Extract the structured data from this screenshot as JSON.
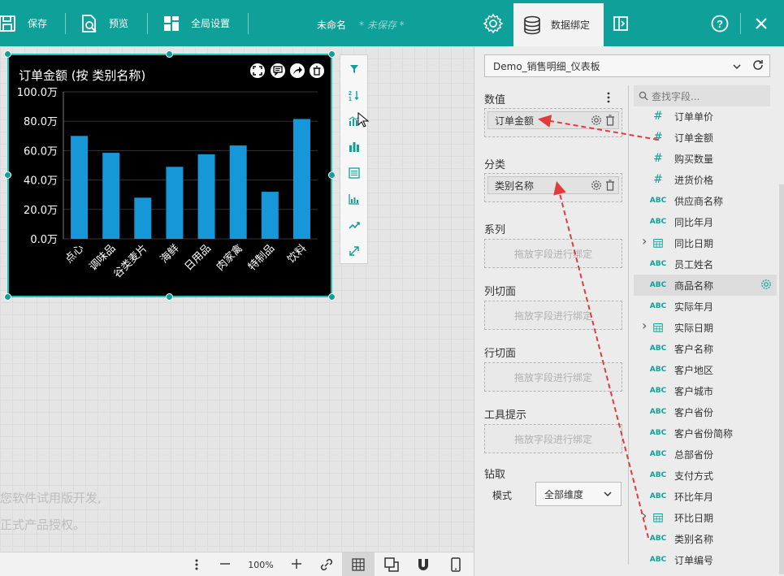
{
  "toolbar": {
    "save": "保存",
    "preview": "预览",
    "global_settings": "全局设置",
    "doc_title": "未命名",
    "unsaved": "* 未保存 *",
    "data_binding": "数据绑定",
    "accent": "#0fa09a"
  },
  "chart_data": {
    "type": "bar",
    "title": "订单金额 (按 类别名称)",
    "categories": [
      "点心",
      "调味品",
      "谷类麦片",
      "海鲜",
      "日用品",
      "肉家禽",
      "特制品",
      "饮料"
    ],
    "values": [
      70,
      58.5,
      28,
      49,
      57.5,
      63.5,
      32,
      81.5
    ],
    "ylim": [
      0,
      100
    ],
    "yticks": [
      "100.0万",
      "80.0万",
      "60.0万",
      "40.0万",
      "20.0万",
      "0.0万"
    ],
    "bar_color": "#1597d8"
  },
  "watermark": {
    "line1": "您软件试用版开发,",
    "line2": "正式产品授权。"
  },
  "bottombar": {
    "zoom": "100%"
  },
  "panel": {
    "datasource": "Demo_销售明细_仪表板",
    "values_label": "数值",
    "values_field": "订单金额",
    "category_label": "分类",
    "category_field": "类别名称",
    "series_label": "系列",
    "col_slice_label": "列切面",
    "row_slice_label": "行切面",
    "tooltip_label": "工具提示",
    "drop_hint": "拖放字段进行绑定",
    "drill_label": "钻取",
    "mode_label": "模式",
    "mode_value": "全部维度",
    "search_placeholder": "查找字段..."
  },
  "fields": [
    {
      "type": "#",
      "name": "订单单价"
    },
    {
      "type": "#",
      "name": "订单金额"
    },
    {
      "type": "#",
      "name": "购买数量"
    },
    {
      "type": "#",
      "name": "进货价格"
    },
    {
      "type": "ABC",
      "name": "供应商名称"
    },
    {
      "type": "ABC",
      "name": "同比年月"
    },
    {
      "type": "date",
      "name": "同比日期"
    },
    {
      "type": "ABC",
      "name": "员工姓名"
    },
    {
      "type": "ABC",
      "name": "商品名称"
    },
    {
      "type": "ABC",
      "name": "实际年月"
    },
    {
      "type": "date",
      "name": "实际日期"
    },
    {
      "type": "ABC",
      "name": "客户名称"
    },
    {
      "type": "ABC",
      "name": "客户地区"
    },
    {
      "type": "ABC",
      "name": "客户城市"
    },
    {
      "type": "ABC",
      "name": "客户省份"
    },
    {
      "type": "ABC",
      "name": "客户省份简称"
    },
    {
      "type": "ABC",
      "name": "总部省份"
    },
    {
      "type": "ABC",
      "name": "支付方式"
    },
    {
      "type": "ABC",
      "name": "环比年月"
    },
    {
      "type": "date",
      "name": "环比日期"
    },
    {
      "type": "ABC",
      "name": "类别名称"
    },
    {
      "type": "ABC",
      "name": "订单编号"
    }
  ]
}
